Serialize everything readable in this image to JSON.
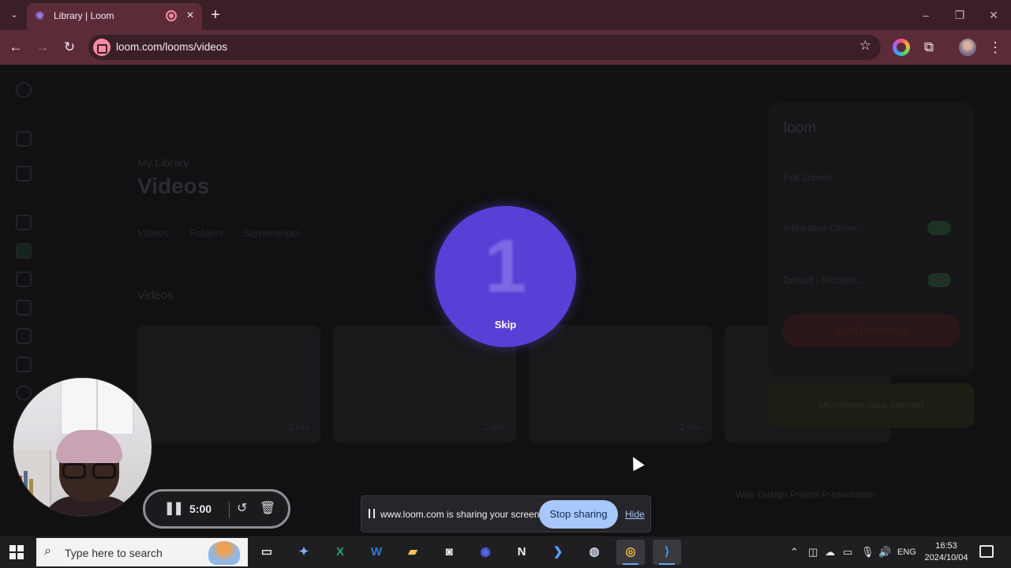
{
  "browser": {
    "tab_title": "Library | Loom",
    "new_tab_icon": "+",
    "url": "loom.com/looms/videos",
    "window_controls": {
      "minimize": "–",
      "maximize": "❐",
      "close": "✕"
    }
  },
  "page": {
    "subtitle": "My Library",
    "title": "Videos",
    "tabs": [
      "Videos",
      "Folders",
      "Screenshots"
    ],
    "section": "Videos",
    "cards": [
      {
        "duration": "2 min",
        "title": ""
      },
      {
        "duration": "2 min",
        "title": ""
      },
      {
        "duration": "2 min",
        "title": ""
      },
      {
        "duration": "",
        "title": "Web Design Project Presentation"
      }
    ]
  },
  "loom_panel": {
    "logo": "loom",
    "rows": [
      "Full Screen",
      "Integrated Camer...",
      "Default - Microph..."
    ],
    "toggle_labels": [
      "On",
      "On"
    ],
    "start_label": "Start Recording",
    "mic_issue": "Microphone issue detected"
  },
  "countdown": {
    "number": "1",
    "skip_label": "Skip"
  },
  "recording": {
    "time": "5:00"
  },
  "sharing_bar": {
    "message": "www.loom.com is sharing your screen.",
    "stop_label": "Stop sharing",
    "hide_label": "Hide"
  },
  "taskbar": {
    "search_placeholder": "Type here to search",
    "apps": [
      {
        "name": "task-view",
        "glyph": "▭",
        "color": "#e6e6e6"
      },
      {
        "name": "copilot",
        "glyph": "✦",
        "color": "#7ab8ff"
      },
      {
        "name": "excel",
        "glyph": "X",
        "color": "#21a366"
      },
      {
        "name": "word",
        "glyph": "W",
        "color": "#2b7cd3"
      },
      {
        "name": "file-explorer",
        "glyph": "▰",
        "color": "#f3c64a"
      },
      {
        "name": "capture",
        "glyph": "◙",
        "color": "#f0f0f0"
      },
      {
        "name": "discord",
        "glyph": "◉",
        "color": "#5865f2"
      },
      {
        "name": "notion",
        "glyph": "N",
        "color": "#f0f0f0"
      },
      {
        "name": "powershell",
        "glyph": "❯",
        "color": "#5aa0ff"
      },
      {
        "name": "steam",
        "glyph": "◍",
        "color": "#d0d8e8"
      },
      {
        "name": "chrome",
        "glyph": "◎",
        "color": "#f2c230"
      },
      {
        "name": "vscode",
        "glyph": "⟩",
        "color": "#3aa0f0"
      }
    ],
    "language": "ENG",
    "time": "16:53",
    "date": "2024/10/04"
  }
}
